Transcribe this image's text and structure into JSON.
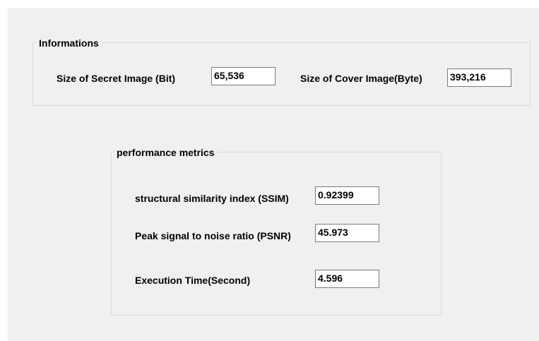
{
  "informations": {
    "title": "Informations",
    "secret_label": "Size of Secret Image (Bit)",
    "secret_value": "65,536",
    "cover_label": "Size of Cover Image(Byte)",
    "cover_value": "393,216"
  },
  "performance": {
    "title": "performance metrics",
    "ssim_label": "structural similarity index (SSIM)",
    "ssim_value": "0.92399",
    "psnr_label": "Peak signal to noise ratio (PSNR)",
    "psnr_value": "45.973",
    "time_label": "Execution Time(Second)",
    "time_value": "4.596"
  },
  "colors": {
    "panel_bg": "#f0f0f0",
    "group_border": "#d8d8d8",
    "textbox_border": "#7a7a7a"
  }
}
